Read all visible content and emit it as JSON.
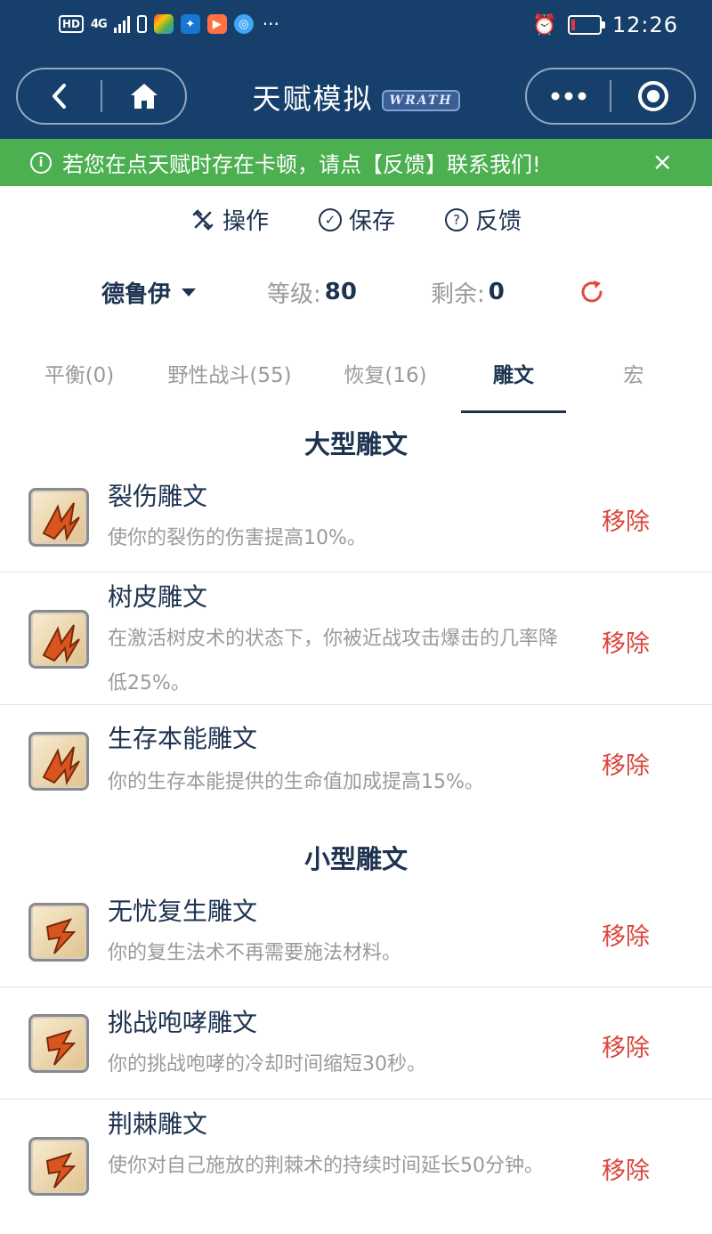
{
  "status_bar": {
    "hd": "HD",
    "network": "4G",
    "more": "···",
    "time": "12:26"
  },
  "nav": {
    "title": "天赋模拟",
    "logo_text": "WRATH",
    "back_icon": "chevron-left-icon",
    "home_icon": "home-icon",
    "more_icon": "more-dots-icon",
    "close_icon": "target-icon"
  },
  "banner": {
    "text": "若您在点天赋时存在卡顿，请点【反馈】联系我们!",
    "close": "×"
  },
  "actions": [
    {
      "label": "操作",
      "icon": "wrench-icon"
    },
    {
      "label": "保存",
      "icon": "check-circle-icon"
    },
    {
      "label": "反馈",
      "icon": "question-circle-icon"
    }
  ],
  "info": {
    "class_name": "德鲁伊",
    "level_label": "等级:",
    "level_value": "80",
    "remain_label": "剩余:",
    "remain_value": "0",
    "refresh_icon": "refresh-icon"
  },
  "tabs": [
    {
      "label": "平衡(0)",
      "active": false
    },
    {
      "label": "野性战斗(55)",
      "active": false
    },
    {
      "label": "恢复(16)",
      "active": false
    },
    {
      "label": "雕文",
      "active": true
    },
    {
      "label": "宏",
      "active": false
    }
  ],
  "major": {
    "title": "大型雕文",
    "items": [
      {
        "name": "裂伤雕文",
        "desc": "使你的裂伤的伤害提高10%。",
        "action": "移除"
      },
      {
        "name": "树皮雕文",
        "desc": "在激活树皮术的状态下，你被近战攻击爆击的几率降低25%。",
        "action": "移除"
      },
      {
        "name": "生存本能雕文",
        "desc": "你的生存本能提供的生命值加成提高15%。",
        "action": "移除"
      }
    ]
  },
  "minor": {
    "title": "小型雕文",
    "items": [
      {
        "name": "无忧复生雕文",
        "desc": "你的复生法术不再需要施法材料。",
        "action": "移除"
      },
      {
        "name": "挑战咆哮雕文",
        "desc": "你的挑战咆哮的冷却时间缩短30秒。",
        "action": "移除"
      },
      {
        "name": "荆棘雕文",
        "desc": "使你对自己施放的荆棘术的持续时间延长50分钟。",
        "action": "移除"
      }
    ]
  }
}
